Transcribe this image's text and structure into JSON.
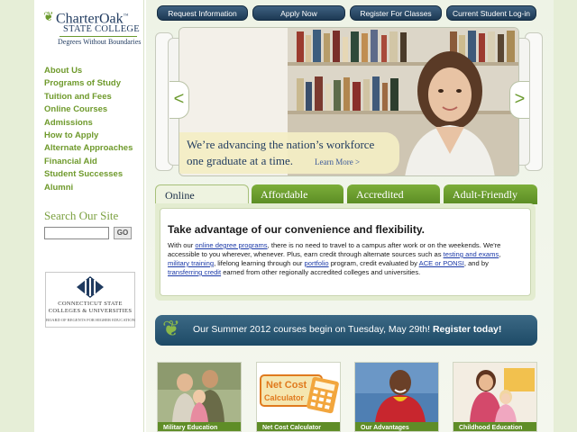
{
  "logo": {
    "name": "CharterOak",
    "tm": "™",
    "subtitle": "STATE COLLEGE",
    "tagline": "Degrees Without Boundaries"
  },
  "nav": {
    "items": [
      "About Us",
      "Programs of Study",
      "Tuition and Fees",
      "Online Courses",
      "Admissions",
      "How to Apply",
      "Alternate Approaches",
      "Financial Aid",
      "Student Successes",
      "Alumni"
    ]
  },
  "search": {
    "title": "Search Our Site",
    "go_label": "GO",
    "value": ""
  },
  "cscu": {
    "line1": "CONNECTICUT STATE",
    "line2": "COLLEGES & UNIVERSITIES",
    "line3": "BOARD OF REGENTS FOR HIGHER EDUCATION"
  },
  "top_buttons": [
    "Request Information",
    "Apply Now",
    "Register For Classes",
    "Current Student Log-in"
  ],
  "hero": {
    "line1": "We’re advancing the nation’s workforce",
    "line2": "one graduate at a time.",
    "learn_more": "Learn More >",
    "prev": "<",
    "next": ">"
  },
  "tabs": [
    "Online",
    "Affordable",
    "Accredited",
    "Adult-Friendly"
  ],
  "panel": {
    "heading": "Take advantage of our convenience and flexibility.",
    "text": {
      "p1": "With our ",
      "link1": "online degree programs",
      "p2": ", there is no need to travel to a campus after work or on the weekends. We're accessible to you wherever, whenever. Plus, earn credit through alternate sources such as ",
      "link2": "testing and exams",
      "p3": ", ",
      "link3": "military training",
      "p4": ", lifelong learning through our ",
      "link4": "portfolio",
      "p5": " program, credit evaluated by ",
      "link5": "ACE or PONSI",
      "p6": ", and by ",
      "link6": "transferring credit",
      "p7": " earned from other regionally accredited colleges and universities."
    }
  },
  "banner": {
    "text": "Our Summer 2012 courses begin on Tuesday, May 29th!",
    "cta": "Register today!"
  },
  "thumbnails": [
    {
      "label": "Military Education"
    },
    {
      "label": "Net Cost Calculator",
      "art_text_1": "Net Cost",
      "art_text_2": "Calculator"
    },
    {
      "label": "Our Advantages"
    },
    {
      "label": "Childhood Education"
    }
  ],
  "colors": {
    "accent_green": "#6f9a2c",
    "navy": "#1f3a5f",
    "button_navy": "#1c3954",
    "banner_blue": "#1d4a66",
    "link_blue": "#1c3aa8"
  }
}
